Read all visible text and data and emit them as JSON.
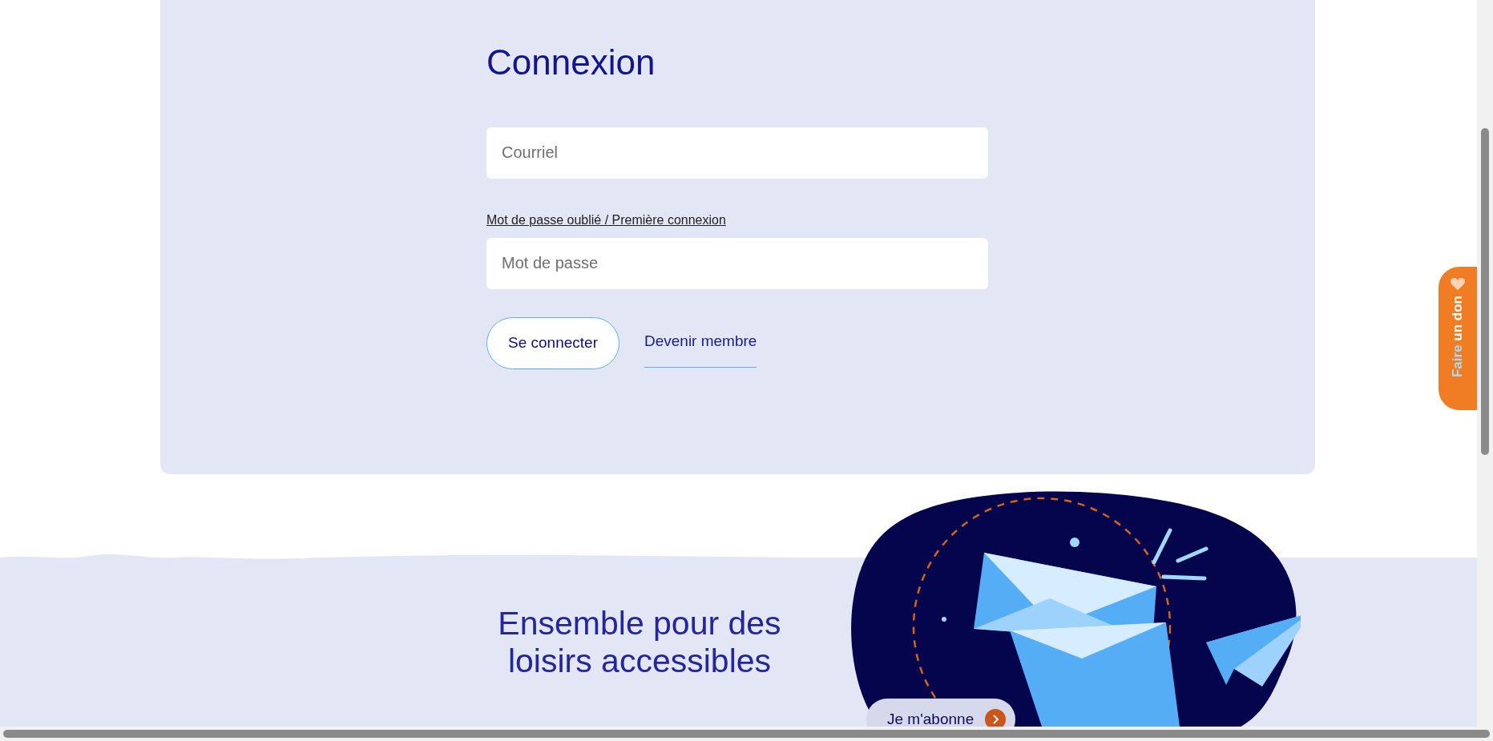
{
  "login": {
    "title": "Connexion",
    "email_field": {
      "placeholder": "Courriel"
    },
    "forgot_link": "Mot de passe oublié / Première connexion",
    "password_field": {
      "placeholder": "Mot de passe"
    },
    "submit_button": "Se connecter",
    "register_link": "Devenir membre"
  },
  "newsletter": {
    "heading": "Ensemble pour des loisirs accessibles",
    "subscribe_button": "Je m'abonne"
  },
  "donate_tab": {
    "highlight": "Faire",
    "label": "un don"
  }
}
